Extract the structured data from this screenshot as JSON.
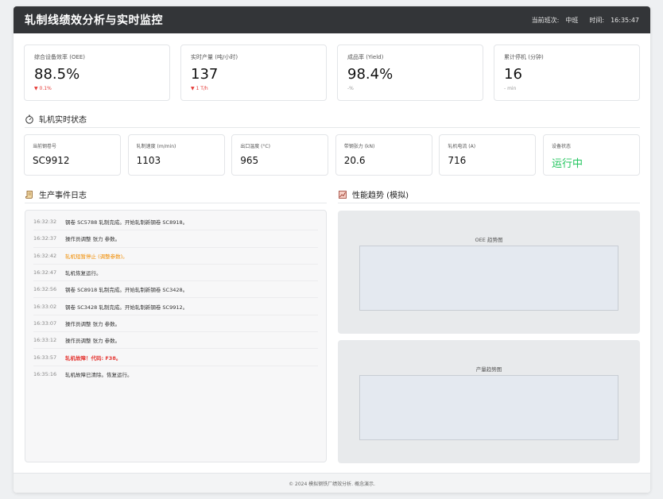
{
  "header": {
    "title": "轧制线绩效分析与实时监控",
    "shift_label": "当前班次:",
    "shift_value": "中班",
    "time_label": "时间:",
    "time_value": "16:35:47"
  },
  "kpis": [
    {
      "label": "综合设备效率 (OEE)",
      "value": "88.5%",
      "sub": "▼ 0.1%",
      "trend": "down"
    },
    {
      "label": "实时产量 (吨/小时)",
      "value": "137",
      "sub": "▼ 1 T/h",
      "trend": "down"
    },
    {
      "label": "成品率 (Yield)",
      "value": "98.4%",
      "sub": "-%",
      "trend": "neutral"
    },
    {
      "label": "累计停机 (分钟)",
      "value": "16",
      "sub": "- min",
      "trend": "neutral"
    }
  ],
  "mill_status": {
    "section_title": "轧机实时状态",
    "items": [
      {
        "label": "当前钢卷号",
        "value": "SC9912"
      },
      {
        "label": "轧制速度 (m/min)",
        "value": "1103"
      },
      {
        "label": "出口温度 (°C)",
        "value": "965"
      },
      {
        "label": "带钢张力 (kN)",
        "value": "20.6"
      },
      {
        "label": "轧机电流 (A)",
        "value": "716"
      },
      {
        "label": "设备状态",
        "value": "运行中"
      }
    ]
  },
  "event_log": {
    "section_title": "生产事件日志",
    "entries": [
      {
        "time": "16:32:32",
        "message": "钢卷 SC5788 轧制完成。开始轧制新钢卷 SC8918。",
        "level": "info"
      },
      {
        "time": "16:32:37",
        "message": "操作员调整 张力 参数。",
        "level": "info"
      },
      {
        "time": "16:32:42",
        "message": "轧机短暂停止 (调整参数)。",
        "level": "warn"
      },
      {
        "time": "16:32:47",
        "message": "轧机恢复运行。",
        "level": "info"
      },
      {
        "time": "16:32:56",
        "message": "钢卷 SC8918 轧制完成。开始轧制新钢卷 SC3428。",
        "level": "info"
      },
      {
        "time": "16:33:02",
        "message": "钢卷 SC3428 轧制完成。开始轧制新钢卷 SC9912。",
        "level": "info"
      },
      {
        "time": "16:33:07",
        "message": "操作员调整 张力 参数。",
        "level": "info"
      },
      {
        "time": "16:33:12",
        "message": "操作员调整 张力 参数。",
        "level": "info"
      },
      {
        "time": "16:33:57",
        "message": "轧机故障！代码: F38。",
        "level": "err"
      },
      {
        "time": "16:35:16",
        "message": "轧机故障已清除。恢复运行。",
        "level": "info"
      }
    ]
  },
  "trends": {
    "section_title": "性能趋势 (模拟)",
    "oee_chart_title": "OEE 趋势图",
    "output_chart_title": "产量趋势图"
  },
  "footer": {
    "text": "© 2024 模拟钢铁厂绩效分析. 概念演示."
  },
  "colors": {
    "header_bg": "#333538",
    "down": "#e53935",
    "warn": "#f08c00",
    "running": "#22c55e"
  }
}
